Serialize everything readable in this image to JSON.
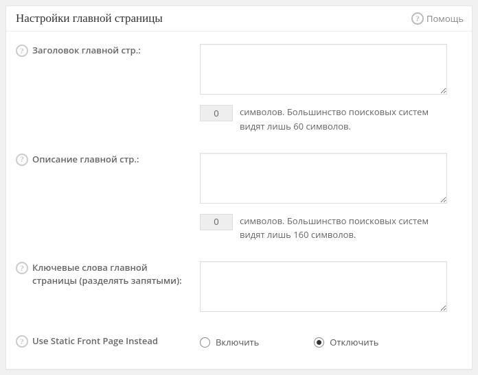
{
  "header": {
    "title": "Настройки главной страницы",
    "help_label": "Помощь"
  },
  "fields": {
    "title_field": {
      "label": "Заголовок главной стр.:",
      "value": "",
      "char_count": "0",
      "hint": "символов. Большинство поисковых систем видят лишь 60 символов."
    },
    "description_field": {
      "label": "Описание главной стр.:",
      "value": "",
      "char_count": "0",
      "hint": "символов. Большинство поисковых систем видят лишь 160 символов."
    },
    "keywords_field": {
      "label": "Ключевые слова главной страницы (разделять запятыми):",
      "value": ""
    },
    "static_front": {
      "label": "Use Static Front Page Instead",
      "option_on": "Включить",
      "option_off": "Отключить",
      "selected": "off"
    }
  }
}
